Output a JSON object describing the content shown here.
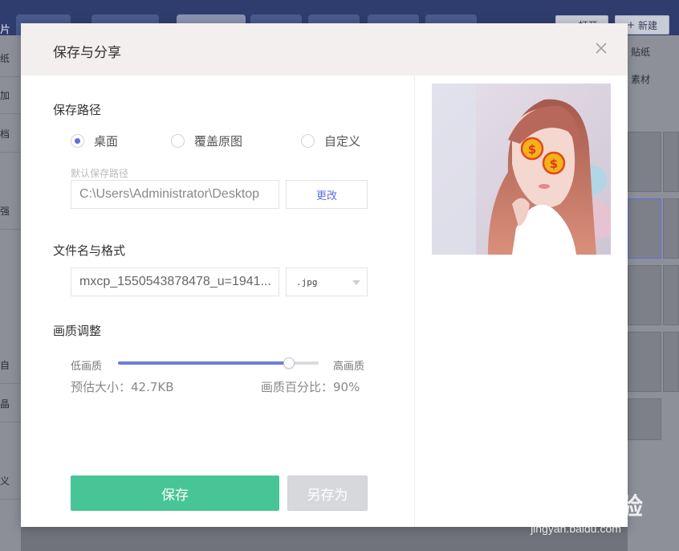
{
  "background_app": {
    "left_labels": [
      "片",
      "纸",
      "加",
      "档",
      "强",
      "自",
      "晶",
      "义"
    ],
    "open_button_label": "打开",
    "new_button_label": "新建",
    "right_panel_labels": [
      "贴纸",
      "素材"
    ]
  },
  "modal": {
    "title": "保存与分享",
    "save_path": {
      "title": "保存路径",
      "options": [
        "桌面",
        "覆盖原图",
        "自定义"
      ],
      "selected_index": 0,
      "hint": "默认保存路径",
      "path_value": "C:\\Users\\Administrator\\Desktop",
      "change_label": "更改"
    },
    "file": {
      "title": "文件名与格式",
      "name_value": "mxcp_1550543878478_u=1941...",
      "format_value": ".jpg"
    },
    "quality": {
      "title": "画质调整",
      "low_label": "低画质",
      "high_label": "高画质",
      "value_fraction": 0.85,
      "est_size_text": "预估大小：42.7KB",
      "percent_text": "画质百分比：90%"
    },
    "save_label": "保存",
    "save_as_label": "另存为"
  },
  "watermark": {
    "logo_text": "Bai du 经验",
    "url_text": "jingyan.baidu.com"
  },
  "colors": {
    "accent": "#5d6ee0",
    "save_green": "#48c597",
    "disabled_gray": "#d7d8db"
  }
}
